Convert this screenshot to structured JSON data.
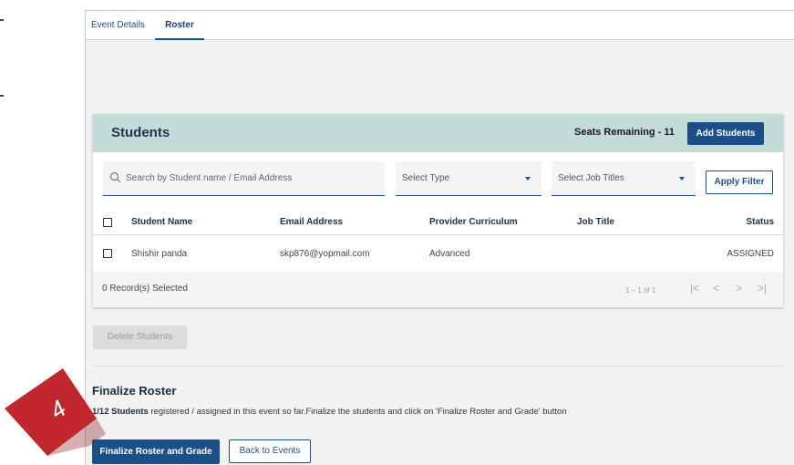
{
  "tabs": [
    {
      "label": "Event Details"
    },
    {
      "label": "Roster"
    }
  ],
  "students_card": {
    "title": "Students",
    "seats_label": "Seats Remaining - 11",
    "add_students_label": "Add Students"
  },
  "filters": {
    "search_placeholder": "Search by Student name / Email Address",
    "type_placeholder": "Select Type",
    "job_titles_placeholder": "Select Job Titles",
    "apply_label": "Apply Filter"
  },
  "table": {
    "columns": [
      "Student Name",
      "Email Address",
      "Provider Curriculum",
      "Job Title",
      "Status"
    ],
    "rows": [
      {
        "name": "Shishir panda",
        "email": "skp876@yopmail.com",
        "curriculum": "Advanced",
        "job_title": "",
        "status": "ASSIGNED"
      }
    ],
    "selected_text": "0 Record(s) Selected",
    "range_text": "1 – 1 of 1"
  },
  "delete_label": "Delete Students",
  "finalize": {
    "title": "Finalize Roster",
    "count_bold": "1/12 Students",
    "description": " registered / assigned in this event so far.Finalize the students and click on 'Finalize Roster and Grade' button",
    "finalize_label": "Finalize Roster and Grade",
    "back_label": "Back to Events"
  },
  "step_badge": "4",
  "colors": {
    "primary": "#1b4f8a",
    "header_band": "#c4dcd9",
    "badge_red": "#c0282d"
  }
}
